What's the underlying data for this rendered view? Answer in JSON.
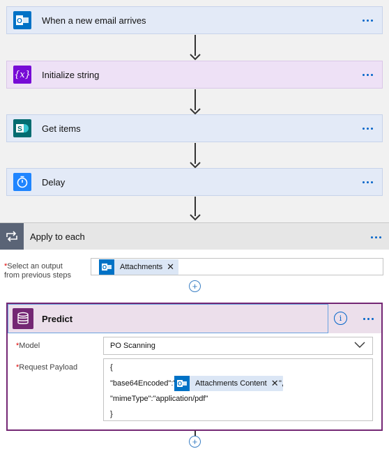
{
  "steps": [
    {
      "title": "When a new email arrives",
      "icon": "outlook-icon",
      "color": "#0072c6"
    },
    {
      "title": "Initialize string",
      "icon": "variable-icon",
      "color": "#770bd6"
    },
    {
      "title": "Get items",
      "icon": "sharepoint-icon",
      "color": "#036c70"
    },
    {
      "title": "Delay",
      "icon": "timer-icon",
      "color": "#1f85ff"
    }
  ],
  "apply_each": {
    "title": "Apply to each",
    "select_label": "Select an output from previous steps",
    "select_label_line1": "Select an output",
    "select_label_line2": "from previous steps",
    "token": "Attachments"
  },
  "predict": {
    "title": "Predict",
    "model_label": "Model",
    "model_value": "PO Scanning",
    "payload_label": "Request Payload",
    "payload": {
      "open_brace": "{",
      "key1": "\"base64Encoded\":\"",
      "token": "Attachments Content",
      "after_token": "\",",
      "line2": "\"mimeType\":\"application/pdf\"",
      "close_brace": "}"
    }
  },
  "accent": "#0064c8",
  "predict_color": "#742774"
}
